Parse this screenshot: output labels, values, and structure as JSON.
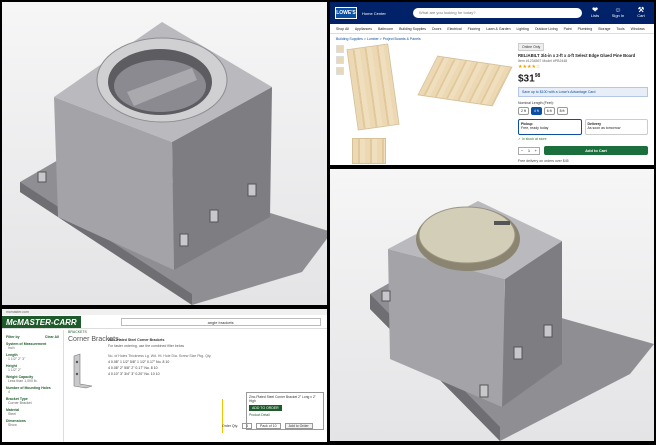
{
  "panels": {
    "cad_top_left": "CAD render of enclosure box with open circular hatch",
    "cad_bottom_right": "CAD render of enclosure box with closed round lid"
  },
  "lowes": {
    "logo": "LOWE'S",
    "store": "Home Center",
    "search_placeholder": "What are you looking for today?",
    "icons": [
      {
        "glyph": "❤",
        "label": "Lists"
      },
      {
        "glyph": "☺",
        "label": "Sign In"
      },
      {
        "glyph": "⚒",
        "label": "Cart"
      }
    ],
    "nav": [
      "Shop All",
      "Appliances",
      "Bathroom",
      "Building Supplies",
      "Doors",
      "Electrical",
      "Flooring",
      "Lawn & Garden",
      "Lighting",
      "Outdoor Living",
      "Paint",
      "Plumbing",
      "Storage",
      "Tools",
      "Windows"
    ],
    "breadcrumb": "Building Supplies > Lumber > Project Boards & Panels",
    "badge": "Online Only",
    "title": "RELIABILT 3/4-in x 2-ft x 4-ft Select Edge Glued Pine Board",
    "subtitle": "Item #1234567  Model #PB2448",
    "stars": "★★★★☆",
    "price_main": "$31",
    "price_cents": "98",
    "promo": "Save up to $100 with a Lowe's Advantage Card",
    "length_label": "Nominal Length (Feet):",
    "lengths": [
      "2 ft",
      "4 ft",
      "6 ft",
      "8 ft"
    ],
    "selected_length": "4 ft",
    "options": [
      {
        "title": "Pickup",
        "detail": "Free, ready today"
      },
      {
        "title": "Delivery",
        "detail": "As soon as tomorrow"
      }
    ],
    "note": "✓ In stock at store",
    "qty": "1",
    "add_to_cart": "Add to Cart",
    "footer": "Free delivery on orders over $45"
  },
  "mcmaster": {
    "topbar": "mcmaster.com",
    "logo": "McMASTER-CARR",
    "search_value": "angle brackets",
    "sidebar": [
      {
        "h": "Filter by",
        "v": "Clear All"
      },
      {
        "h": "System of Measurement",
        "v": "Inch"
      },
      {
        "h": "Length",
        "v": "1 1/2\"   2\"   3\""
      },
      {
        "h": "Height",
        "v": "1 1/2\"   2\""
      },
      {
        "h": "Weight Capacity",
        "v": "Less than 1,000 lb."
      },
      {
        "h": "Number of Mounting Holes",
        "v": "4"
      },
      {
        "h": "Bracket Type",
        "v": "Corner Bracket"
      },
      {
        "h": "Material",
        "v": "Steel"
      },
      {
        "h": "Dimensions",
        "v": "Show"
      }
    ],
    "category_tag": "BRACKETS",
    "category": "Corner Brackets",
    "table_title": "Zinc-Plated Steel Corner Brackets",
    "filter_text": "For faster ordering, use the combined filter below",
    "rows": [
      "No. of Holes   Thickness   Lg.   Wd.   Ht.   Hole Dia.   Screw Size   Pkg. Qty.",
      "4   0.08\"   1 1/2\"   5/8\"   1 1/2\"   0.17\"   No. 8   10",
      "4   0.08\"   2\"   5/8\"   2\"   0.17\"   No. 8   10",
      "4   0.10\"   3\"   3/4\"   3\"   0.20\"   No. 10   10"
    ],
    "popup_text": "Zinc-Plated Steel Corner Bracket 2\" Long x 2\" High",
    "popup_btn": "ADD TO ORDER",
    "popup_link": "Product Detail",
    "qty_label": "Order Qty.",
    "qty_value": "1",
    "unit": "Pack of 10",
    "add": "Add to Order"
  }
}
